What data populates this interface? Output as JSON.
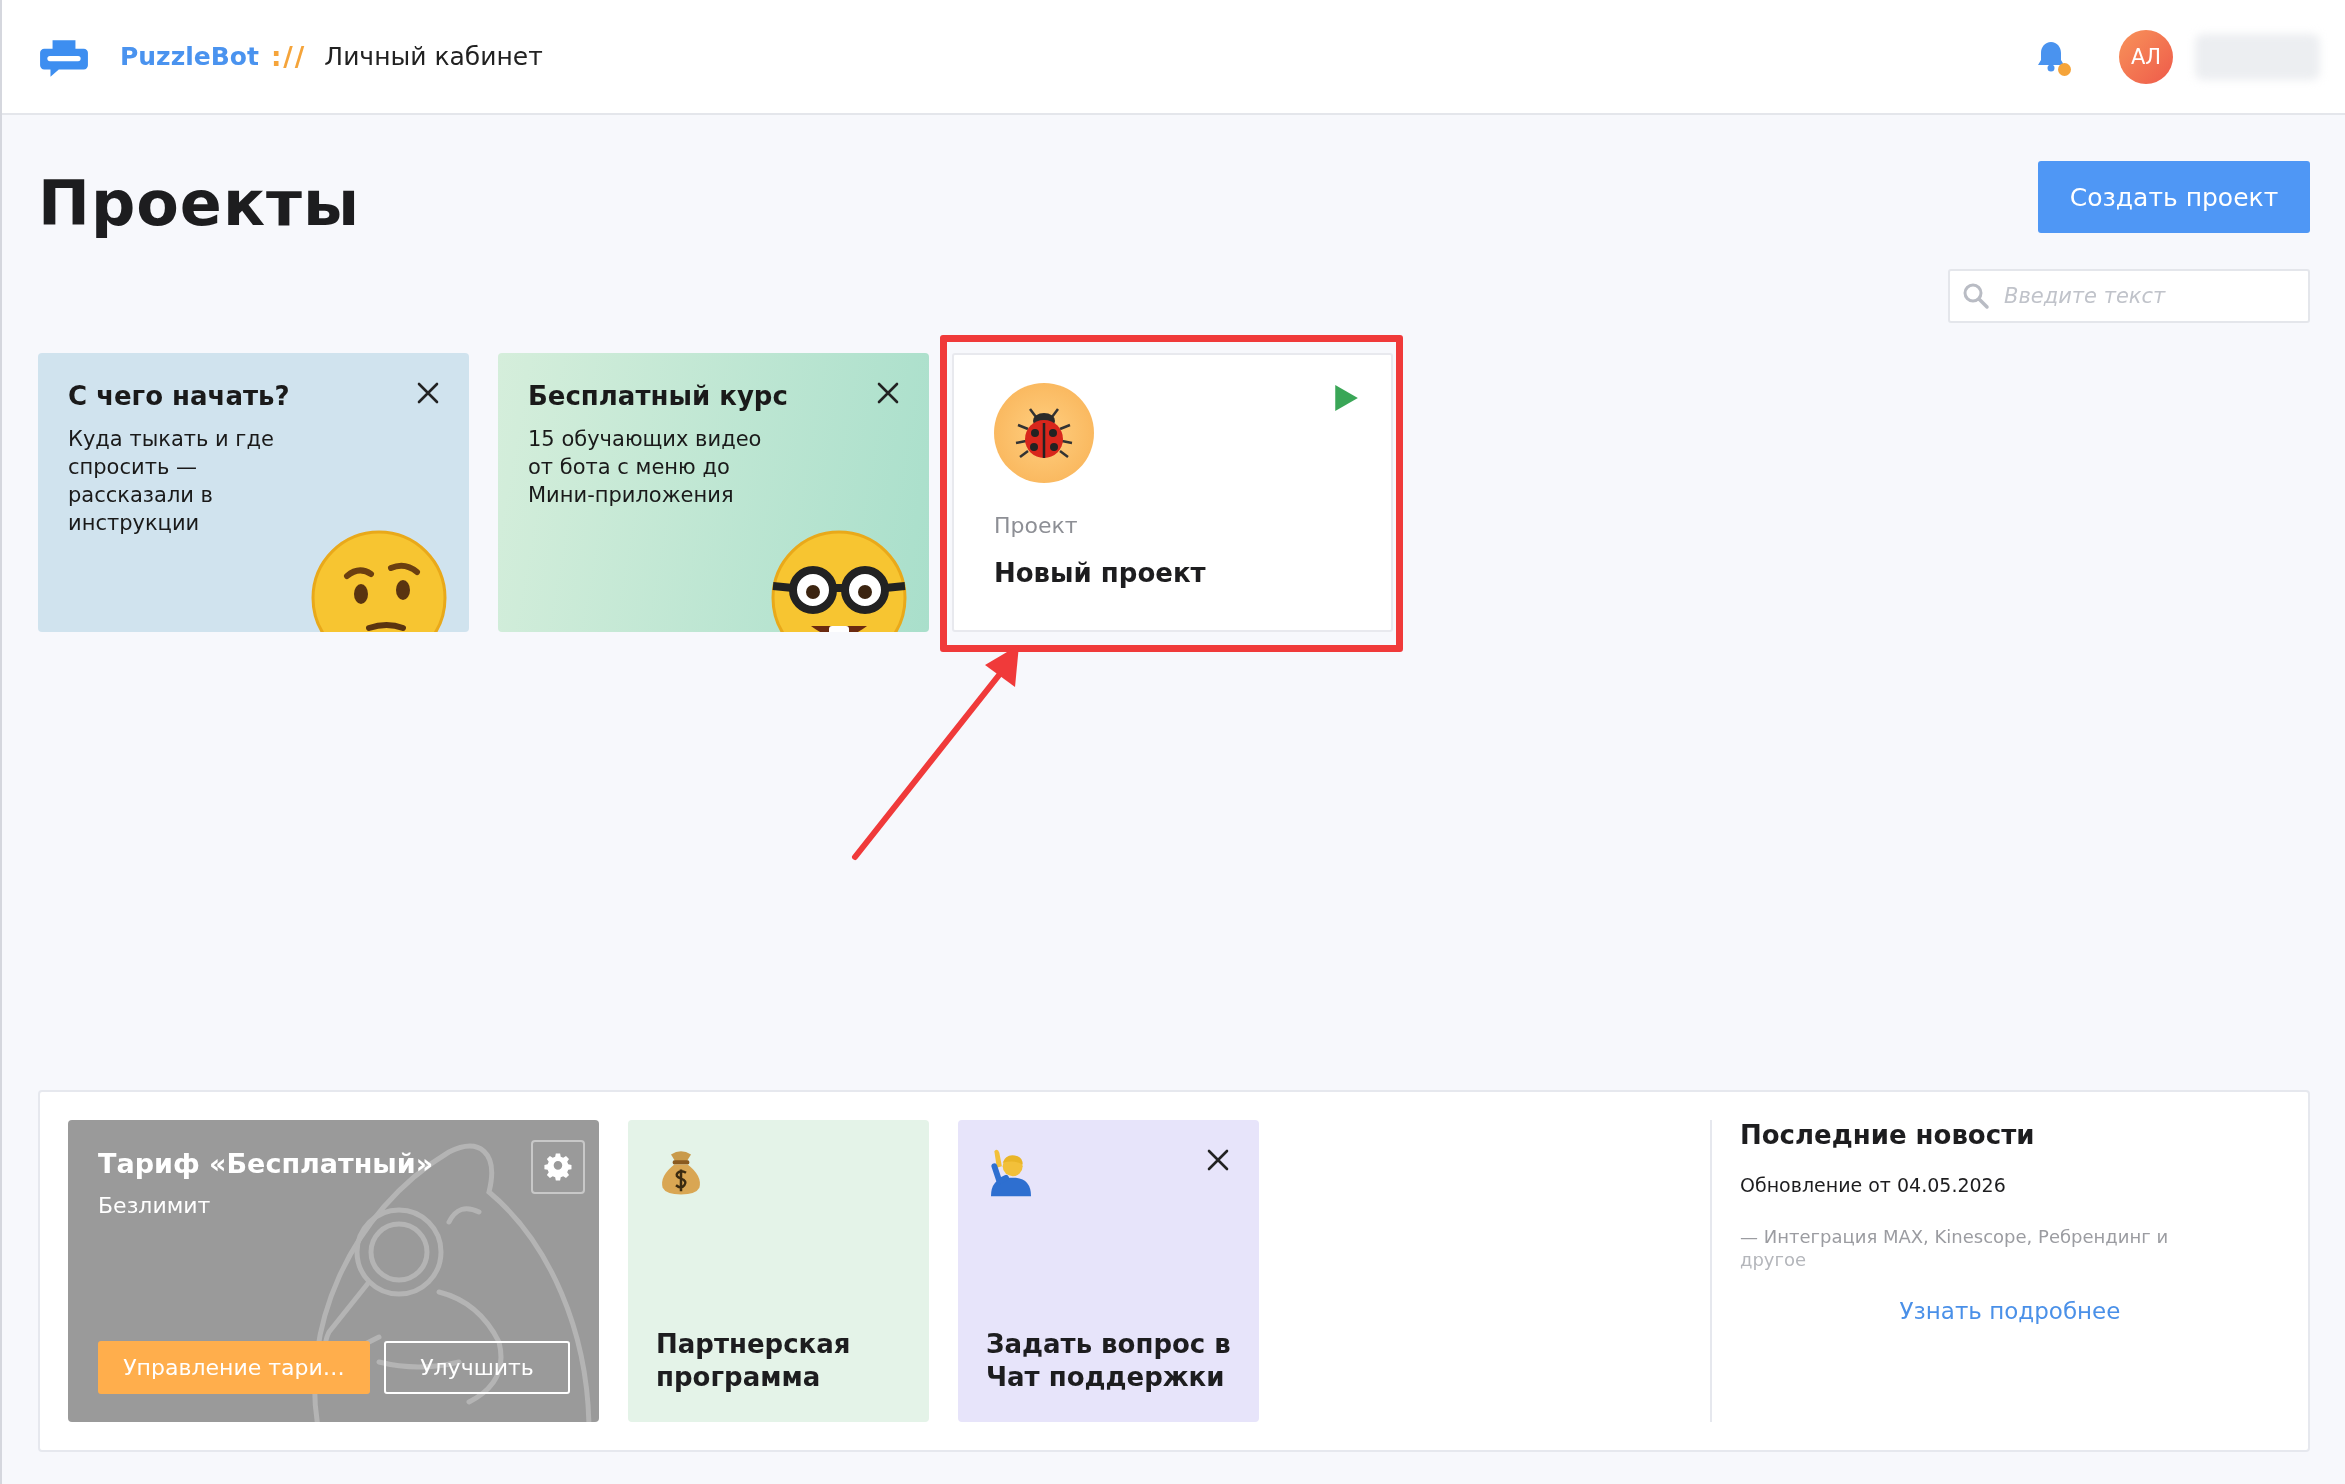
{
  "header": {
    "brand": "PuzzleBot",
    "separator": "://",
    "section": "Личный кабинет",
    "notifications": {
      "unread": true
    },
    "avatar": {
      "initials": "АЛ"
    }
  },
  "page": {
    "title": "Проекты",
    "create_button": "Создать проект",
    "search": {
      "placeholder": "Введите текст"
    }
  },
  "tips": [
    {
      "kind": "thinking",
      "title": "С чего начать?",
      "text": "Куда тыкать и где спросить — рассказали в инструкции",
      "closable": true
    },
    {
      "kind": "nerd",
      "title": "Бесплатный курс",
      "text": "15 обучающих видео от бота с меню до Мини-приложения",
      "closable": true
    }
  ],
  "projects": [
    {
      "label": "Проект",
      "name": "Новый проект",
      "highlighted": true
    }
  ],
  "tariff": {
    "title": "Тариф «Бесплатный»",
    "subtitle": "Безлимит",
    "manage_button": "Управление тари…",
    "upgrade_button": "Улучшить"
  },
  "promos": [
    {
      "kind": "money",
      "title": "Партнерская программа",
      "closable": false
    },
    {
      "kind": "person",
      "title": "Задать вопрос в Чат поддержки",
      "closable": true
    }
  ],
  "news": {
    "title": "Последние новости",
    "date": "Обновление от 04.05.2026",
    "text": "— Интеграция MAX, Kinescope, Ребрендинг и",
    "faded_text": "другое",
    "link": "Узнать подробнее"
  }
}
